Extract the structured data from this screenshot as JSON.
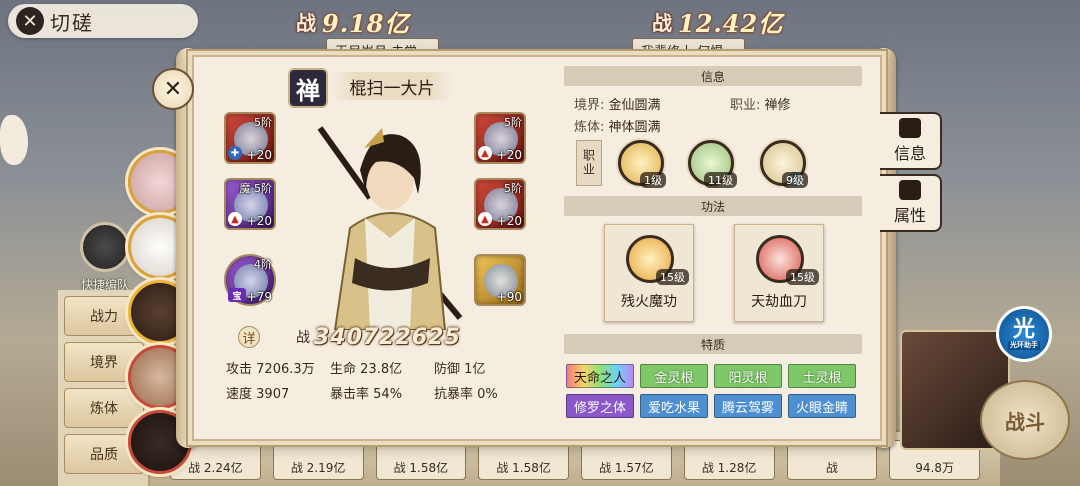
{
  "top": {
    "title": "切磋",
    "left_power_label": "战",
    "left_power": "9.18亿",
    "right_power_label": "战",
    "right_power": "12.42亿",
    "left_team": "无尽岁月 去常一",
    "right_team": "我辈修士 何惧一"
  },
  "quick_edit": "快捷编队",
  "side_tabs": [
    "战力",
    "境界",
    "炼体",
    "品质"
  ],
  "character": {
    "badge": "禅",
    "name": "棍扫一大片",
    "detail_icon": "详",
    "power_label": "战",
    "power": "340722625",
    "equipment": [
      {
        "tier": "5阶",
        "plus": "+20",
        "mark": "✚",
        "color": "red",
        "mark_style": "blue"
      },
      {
        "tier": "5阶",
        "plus": "+20",
        "mark": "▲",
        "color": "red",
        "mark_style": "fire"
      },
      {
        "tier": "魔·5阶",
        "plus": "+20",
        "mark": "▲",
        "color": "purple",
        "mark_style": "fire"
      },
      {
        "tier": "5阶",
        "plus": "+20",
        "mark": "▲",
        "color": "red",
        "mark_style": "fire"
      },
      {
        "tier": "4阶",
        "plus": "+79",
        "mark": "宝",
        "color": "purple",
        "mark_style": "gem"
      },
      {
        "tier": "",
        "plus": "+90",
        "mark": "",
        "color": "gold",
        "mark_style": "none"
      }
    ],
    "stats": [
      {
        "label": "攻击",
        "value": "7206.3万"
      },
      {
        "label": "生命",
        "value": "23.8亿"
      },
      {
        "label": "防御",
        "value": "1亿"
      },
      {
        "label": "速度",
        "value": "3907"
      },
      {
        "label": "暴击率",
        "value": "54%"
      },
      {
        "label": "抗暴率",
        "value": "0%"
      }
    ]
  },
  "info": {
    "header": "信息",
    "realm_label": "境界:",
    "realm": "金仙圆满",
    "job_label": "职业:",
    "job": "禅修",
    "body_label": "炼体:",
    "body": "神体圆满",
    "job_tag": "职业",
    "job_skills": [
      {
        "level": "1级",
        "color": "#e0b04a"
      },
      {
        "level": "11级",
        "color": "#9ac27a"
      },
      {
        "level": "9级",
        "color": "#d9c28a",
        "prefix": "被"
      }
    ]
  },
  "gongfa": {
    "header": "功法",
    "skills": [
      {
        "name": "残火魔功",
        "level": "15级",
        "color": "#e8a43a"
      },
      {
        "name": "天劫血刀",
        "level": "15级",
        "color": "#d8574a"
      }
    ]
  },
  "traits": {
    "header": "特质",
    "items": [
      {
        "label": "天命之人",
        "style": "t-rainbow"
      },
      {
        "label": "金灵根",
        "style": "t-green"
      },
      {
        "label": "阳灵根",
        "style": "t-green"
      },
      {
        "label": "土灵根",
        "style": "t-green"
      },
      {
        "label": "修罗之体",
        "style": "t-purple"
      },
      {
        "label": "爱吃水果",
        "style": "t-blue"
      },
      {
        "label": "腾云驾雾",
        "style": "t-blue"
      },
      {
        "label": "火眼金睛",
        "style": "t-blue"
      }
    ]
  },
  "side_buttons": {
    "info": "信息",
    "attr": "属性"
  },
  "assist": {
    "glyph": "光",
    "label": "光环助手"
  },
  "fight": "战斗",
  "bottom_powers": [
    "战 2.24亿",
    "战 2.19亿",
    "战 1.58亿",
    "战 1.58亿",
    "战 1.57亿",
    "战 1.28亿",
    "战",
    "94.8万"
  ]
}
